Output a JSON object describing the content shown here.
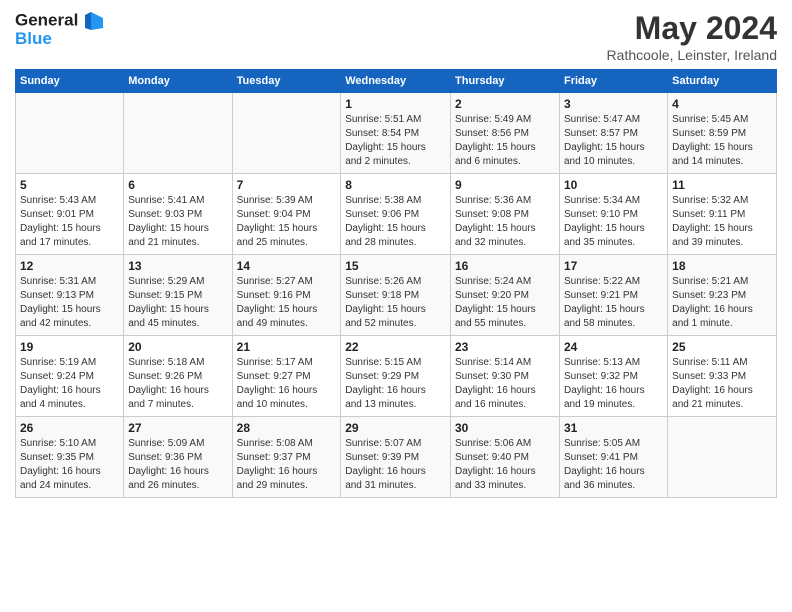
{
  "header": {
    "logo_line1": "General",
    "logo_line2": "Blue",
    "title": "May 2024",
    "subtitle": "Rathcoole, Leinster, Ireland"
  },
  "calendar": {
    "days_of_week": [
      "Sunday",
      "Monday",
      "Tuesday",
      "Wednesday",
      "Thursday",
      "Friday",
      "Saturday"
    ],
    "weeks": [
      [
        {
          "day": "",
          "info": ""
        },
        {
          "day": "",
          "info": ""
        },
        {
          "day": "",
          "info": ""
        },
        {
          "day": "1",
          "info": "Sunrise: 5:51 AM\nSunset: 8:54 PM\nDaylight: 15 hours\nand 2 minutes."
        },
        {
          "day": "2",
          "info": "Sunrise: 5:49 AM\nSunset: 8:56 PM\nDaylight: 15 hours\nand 6 minutes."
        },
        {
          "day": "3",
          "info": "Sunrise: 5:47 AM\nSunset: 8:57 PM\nDaylight: 15 hours\nand 10 minutes."
        },
        {
          "day": "4",
          "info": "Sunrise: 5:45 AM\nSunset: 8:59 PM\nDaylight: 15 hours\nand 14 minutes."
        }
      ],
      [
        {
          "day": "5",
          "info": "Sunrise: 5:43 AM\nSunset: 9:01 PM\nDaylight: 15 hours\nand 17 minutes."
        },
        {
          "day": "6",
          "info": "Sunrise: 5:41 AM\nSunset: 9:03 PM\nDaylight: 15 hours\nand 21 minutes."
        },
        {
          "day": "7",
          "info": "Sunrise: 5:39 AM\nSunset: 9:04 PM\nDaylight: 15 hours\nand 25 minutes."
        },
        {
          "day": "8",
          "info": "Sunrise: 5:38 AM\nSunset: 9:06 PM\nDaylight: 15 hours\nand 28 minutes."
        },
        {
          "day": "9",
          "info": "Sunrise: 5:36 AM\nSunset: 9:08 PM\nDaylight: 15 hours\nand 32 minutes."
        },
        {
          "day": "10",
          "info": "Sunrise: 5:34 AM\nSunset: 9:10 PM\nDaylight: 15 hours\nand 35 minutes."
        },
        {
          "day": "11",
          "info": "Sunrise: 5:32 AM\nSunset: 9:11 PM\nDaylight: 15 hours\nand 39 minutes."
        }
      ],
      [
        {
          "day": "12",
          "info": "Sunrise: 5:31 AM\nSunset: 9:13 PM\nDaylight: 15 hours\nand 42 minutes."
        },
        {
          "day": "13",
          "info": "Sunrise: 5:29 AM\nSunset: 9:15 PM\nDaylight: 15 hours\nand 45 minutes."
        },
        {
          "day": "14",
          "info": "Sunrise: 5:27 AM\nSunset: 9:16 PM\nDaylight: 15 hours\nand 49 minutes."
        },
        {
          "day": "15",
          "info": "Sunrise: 5:26 AM\nSunset: 9:18 PM\nDaylight: 15 hours\nand 52 minutes."
        },
        {
          "day": "16",
          "info": "Sunrise: 5:24 AM\nSunset: 9:20 PM\nDaylight: 15 hours\nand 55 minutes."
        },
        {
          "day": "17",
          "info": "Sunrise: 5:22 AM\nSunset: 9:21 PM\nDaylight: 15 hours\nand 58 minutes."
        },
        {
          "day": "18",
          "info": "Sunrise: 5:21 AM\nSunset: 9:23 PM\nDaylight: 16 hours\nand 1 minute."
        }
      ],
      [
        {
          "day": "19",
          "info": "Sunrise: 5:19 AM\nSunset: 9:24 PM\nDaylight: 16 hours\nand 4 minutes."
        },
        {
          "day": "20",
          "info": "Sunrise: 5:18 AM\nSunset: 9:26 PM\nDaylight: 16 hours\nand 7 minutes."
        },
        {
          "day": "21",
          "info": "Sunrise: 5:17 AM\nSunset: 9:27 PM\nDaylight: 16 hours\nand 10 minutes."
        },
        {
          "day": "22",
          "info": "Sunrise: 5:15 AM\nSunset: 9:29 PM\nDaylight: 16 hours\nand 13 minutes."
        },
        {
          "day": "23",
          "info": "Sunrise: 5:14 AM\nSunset: 9:30 PM\nDaylight: 16 hours\nand 16 minutes."
        },
        {
          "day": "24",
          "info": "Sunrise: 5:13 AM\nSunset: 9:32 PM\nDaylight: 16 hours\nand 19 minutes."
        },
        {
          "day": "25",
          "info": "Sunrise: 5:11 AM\nSunset: 9:33 PM\nDaylight: 16 hours\nand 21 minutes."
        }
      ],
      [
        {
          "day": "26",
          "info": "Sunrise: 5:10 AM\nSunset: 9:35 PM\nDaylight: 16 hours\nand 24 minutes."
        },
        {
          "day": "27",
          "info": "Sunrise: 5:09 AM\nSunset: 9:36 PM\nDaylight: 16 hours\nand 26 minutes."
        },
        {
          "day": "28",
          "info": "Sunrise: 5:08 AM\nSunset: 9:37 PM\nDaylight: 16 hours\nand 29 minutes."
        },
        {
          "day": "29",
          "info": "Sunrise: 5:07 AM\nSunset: 9:39 PM\nDaylight: 16 hours\nand 31 minutes."
        },
        {
          "day": "30",
          "info": "Sunrise: 5:06 AM\nSunset: 9:40 PM\nDaylight: 16 hours\nand 33 minutes."
        },
        {
          "day": "31",
          "info": "Sunrise: 5:05 AM\nSunset: 9:41 PM\nDaylight: 16 hours\nand 36 minutes."
        },
        {
          "day": "",
          "info": ""
        }
      ]
    ]
  }
}
